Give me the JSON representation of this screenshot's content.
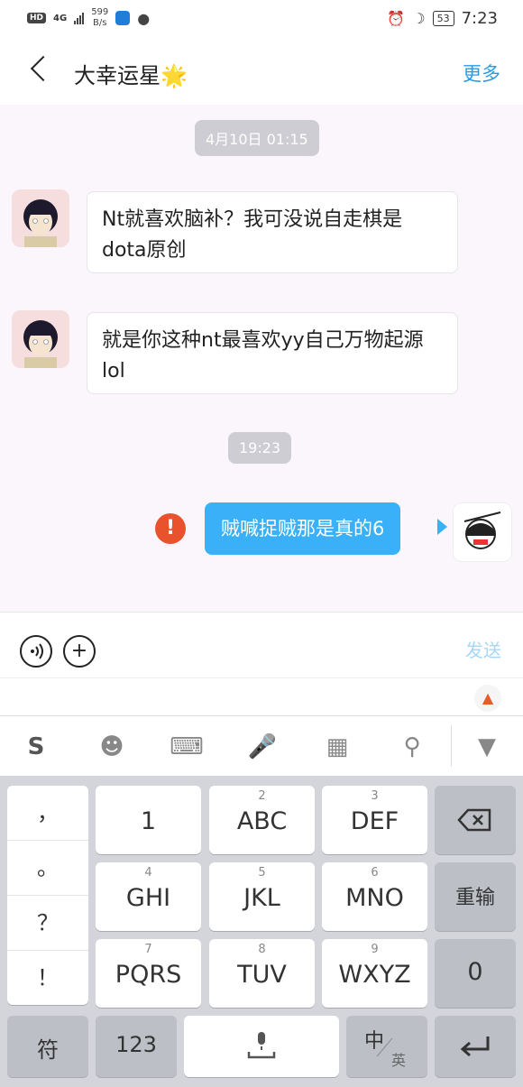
{
  "status_bar": {
    "left_badge": "HD",
    "network": "4G",
    "speed_value": "599",
    "speed_unit": "B/s",
    "battery": "53",
    "time": "7:23"
  },
  "header": {
    "title": "大幸运星🌟",
    "more_label": "更多"
  },
  "chat": {
    "timestamps": [
      "4月10日 01:15",
      "19:23"
    ],
    "messages": [
      {
        "side": "in",
        "text": "Nt就喜欢脑补？我可没说自走棋是dota原创"
      },
      {
        "side": "in",
        "text": "就是你这种nt最喜欢yy自己万物起源lol"
      },
      {
        "side": "out",
        "text": "贼喊捉贼那是真的6",
        "status": "failed"
      }
    ]
  },
  "input": {
    "voice_icon": "voice-icon",
    "plus_icon": "plus-icon",
    "send_label": "发送"
  },
  "keyboard_toolbar": {
    "icons": [
      "sogou-logo-icon",
      "emoji-icon",
      "keyboard-icon",
      "mic-icon",
      "grid-icon",
      "search-icon",
      "collapse-icon"
    ]
  },
  "keyboard": {
    "punct": [
      "，",
      "。",
      "？",
      "！"
    ],
    "row1": [
      {
        "num": "",
        "label": "1"
      },
      {
        "num": "2",
        "label": "ABC"
      },
      {
        "num": "3",
        "label": "DEF"
      }
    ],
    "row2": [
      {
        "num": "4",
        "label": "GHI"
      },
      {
        "num": "5",
        "label": "JKL"
      },
      {
        "num": "6",
        "label": "MNO"
      }
    ],
    "row3": [
      {
        "num": "7",
        "label": "PQRS"
      },
      {
        "num": "8",
        "label": "TUV"
      },
      {
        "num": "9",
        "label": "WXYZ"
      }
    ],
    "reinput_label": "重输",
    "zero_label": "0",
    "symbol_label": "符",
    "num_label": "123",
    "lang_main": "中",
    "lang_sub": "英"
  },
  "colors": {
    "accent": "#2a9be5",
    "bubble_out": "#3ab0f8",
    "error": "#e8532e",
    "chat_bg": "#fbf6fb"
  }
}
